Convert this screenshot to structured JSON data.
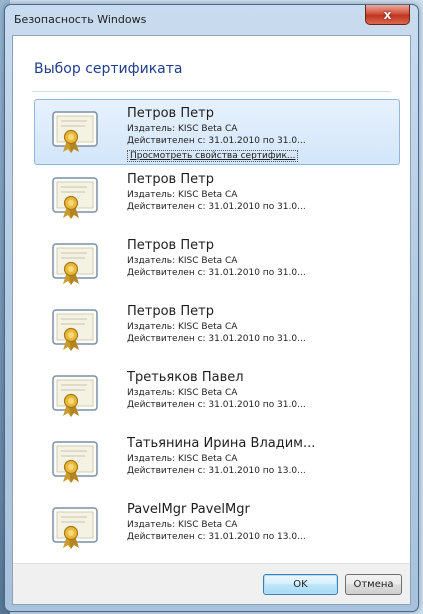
{
  "window": {
    "title": "Безопасность Windows",
    "close_label": "x"
  },
  "dialog": {
    "heading": "Выбор сертификата"
  },
  "certificates": [
    {
      "name": "Петров Петр",
      "issuer": "Издатель: KISC Beta CA",
      "validity": "Действителен с: 31.01.2010 по 31.0...",
      "properties_link": "Просмотреть свойства сертифик...",
      "selected": true
    },
    {
      "name": "Петров Петр",
      "issuer": "Издатель: KISC Beta CA",
      "validity": "Действителен с: 31.01.2010 по 31.0..."
    },
    {
      "name": "Петров Петр",
      "issuer": "Издатель: KISC Beta CA",
      "validity": "Действителен с: 31.01.2010 по 31.0..."
    },
    {
      "name": "Петров Петр",
      "issuer": "Издатель: KISC Beta CA",
      "validity": "Действителен с: 31.01.2010 по 31.0..."
    },
    {
      "name": "Третьяков Павел",
      "issuer": "Издатель: KISC Beta CA",
      "validity": "Действителен с: 31.01.2010 по 31.0..."
    },
    {
      "name": "Татьянина Ирина Владим...",
      "issuer": "Издатель: KISC Beta CA",
      "validity": "Действителен с: 31.01.2010 по 13.0..."
    },
    {
      "name": "PavelMgr PavelMgr",
      "issuer": "Издатель: KISC Beta CA",
      "validity": "Действителен с: 31.01.2010 по 13.0..."
    }
  ],
  "buttons": {
    "ok": "OK",
    "cancel": "Отмена"
  },
  "icons": {
    "certificate": "certificate-icon",
    "close": "close-icon"
  },
  "colors": {
    "heading": "#1f3f8a",
    "selection": "#d3e6fa",
    "close_button": "#c1341f"
  }
}
